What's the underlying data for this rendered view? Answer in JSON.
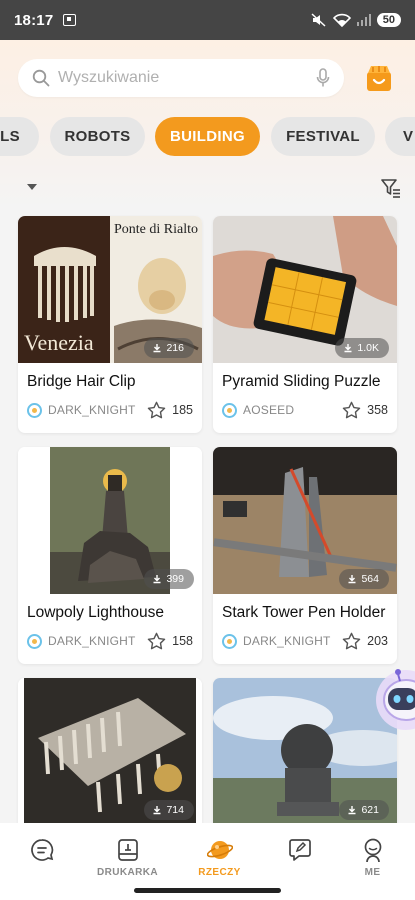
{
  "status_bar": {
    "time": "18:17",
    "battery": "50"
  },
  "search": {
    "placeholder": "Wyszukiwanie"
  },
  "categories": [
    {
      "label": "ALS"
    },
    {
      "label": "ROBOTS"
    },
    {
      "label": "BUILDING",
      "active": true
    },
    {
      "label": "FESTIVAL"
    },
    {
      "label": "V"
    }
  ],
  "cards": [
    {
      "title": "Bridge Hair Clip",
      "author": "DARK_KNIGHT",
      "likes": "185",
      "downloads": "216",
      "image_text": {
        "left": "Venezia",
        "right": "Ponte di Rialto"
      }
    },
    {
      "title": "Pyramid Sliding Puzzle",
      "author": "AOSEED",
      "likes": "358",
      "downloads": "1.0K"
    },
    {
      "title": "Lowpoly Lighthouse",
      "author": "DARK_KNIGHT",
      "likes": "158",
      "downloads": "399"
    },
    {
      "title": "Stark Tower Pen Holder",
      "author": "DARK_KNIGHT",
      "likes": "203",
      "downloads": "564"
    },
    {
      "title": "",
      "author": "",
      "likes": "",
      "downloads": "714"
    },
    {
      "title": "",
      "author": "",
      "likes": "",
      "downloads": "621"
    }
  ],
  "bottom_nav": [
    {
      "label": "",
      "icon": "chat-icon"
    },
    {
      "label": "DRUKARKA",
      "icon": "printer-icon"
    },
    {
      "label": "RZECZY",
      "icon": "planet-icon",
      "active": true
    },
    {
      "label": "",
      "icon": "compose-icon"
    },
    {
      "label": "ME",
      "icon": "profile-icon"
    }
  ],
  "colors": {
    "accent": "#f39a1e",
    "chip_bg": "#e6e6e6",
    "status_bar": "#454545"
  }
}
